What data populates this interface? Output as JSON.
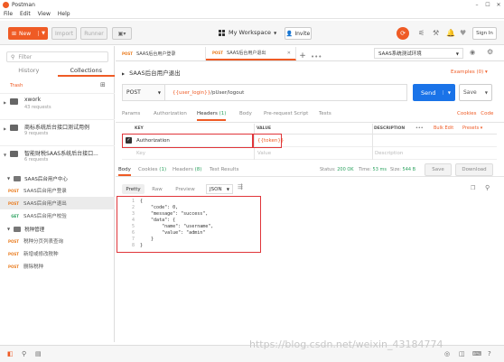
{
  "window": {
    "title": "Postman",
    "controls": [
      "–",
      "☐",
      "✕"
    ]
  },
  "menu": [
    "File",
    "Edit",
    "View",
    "Help"
  ],
  "toolbar": {
    "new_label": "New",
    "import_label": "Import",
    "runner_label": "Runner",
    "workspace_label": "My Workspace",
    "invite_label": "Invite",
    "signin_label": "Sign In"
  },
  "sidebar": {
    "filter_placeholder": "Filter",
    "tabs": [
      "History",
      "Collections"
    ],
    "trash_label": "Trash",
    "collections": [
      {
        "name": "xwork",
        "count": "43 requests"
      },
      {
        "name": "商标系统后台接口测试用例",
        "count": "9 requests"
      },
      {
        "name": "智能财税SAAS系统后台接口...",
        "count": "6 requests"
      }
    ],
    "tree": [
      {
        "kind": "folder",
        "label": "SAAS后台用户中心"
      },
      {
        "kind": "req",
        "method": "POST",
        "label": "SAAS后台用户登录"
      },
      {
        "kind": "req",
        "method": "POST",
        "label": "SAAS后台用户退出",
        "selected": true
      },
      {
        "kind": "req",
        "method": "GET",
        "label": "SAAS后台用户校验"
      },
      {
        "kind": "folder",
        "label": "税种管理"
      },
      {
        "kind": "req",
        "method": "POST",
        "label": "税种分页列表查询"
      },
      {
        "kind": "req",
        "method": "POST",
        "label": "新增或修改税种"
      },
      {
        "kind": "req",
        "method": "POST",
        "label": "删除税种"
      }
    ]
  },
  "tabs": [
    {
      "method": "POST",
      "label": "SAAS后台用户登录"
    },
    {
      "method": "POST",
      "label": "SAAS后台用户退出"
    }
  ],
  "environment": "SAAS系统测试环境",
  "request": {
    "name": "SAAS后台用户退出",
    "examples": "Examples (0) ▾",
    "method": "POST",
    "url_var": "{{user_login}}",
    "url_path": "/pUser/logout",
    "send_label": "Send",
    "save_label": "Save"
  },
  "param_tabs": {
    "params": "Params",
    "authorization": "Authorization",
    "headers": "Headers",
    "headers_count": "(1)",
    "body": "Body",
    "prerequest": "Pre-request Script",
    "tests": "Tests",
    "cookies": "Cookies",
    "code": "Code"
  },
  "headers_table": {
    "key_col": "KEY",
    "value_col": "VALUE",
    "desc_col": "DESCRIPTION",
    "more": "•••",
    "bulk_edit": "Bulk Edit",
    "presets": "Presets ▾",
    "row_key": "Authorization",
    "row_value": "{{token}}",
    "key_placeholder": "Key",
    "value_placeholder": "Value",
    "desc_placeholder": "Description"
  },
  "response": {
    "tabs": {
      "body": "Body",
      "cookies": "Cookies",
      "cookies_count": "(1)",
      "headers": "Headers",
      "headers_count": "(8)",
      "tests": "Test Results"
    },
    "status_label": "Status:",
    "status": "200 OK",
    "time_label": "Time:",
    "time": "53 ms",
    "size_label": "Size:",
    "size": "544 B",
    "save_label": "Save",
    "download_label": "Download",
    "formats": [
      "Pretty",
      "Raw",
      "Preview"
    ],
    "format_type": "JSON"
  },
  "code_lines": [
    {
      "n": "1",
      "t": "{"
    },
    {
      "n": "2",
      "t": "    \"code\": 0,"
    },
    {
      "n": "3",
      "t": "    \"message\": \"success\","
    },
    {
      "n": "4",
      "t": "    \"data\": {"
    },
    {
      "n": "5",
      "t": "        \"name\": \"username\","
    },
    {
      "n": "6",
      "t": "        \"value\": \"admin\""
    },
    {
      "n": "7",
      "t": "    }"
    },
    {
      "n": "8",
      "t": "}"
    }
  ],
  "watermark": "https://blog.csdn.net/weixin_43184774"
}
